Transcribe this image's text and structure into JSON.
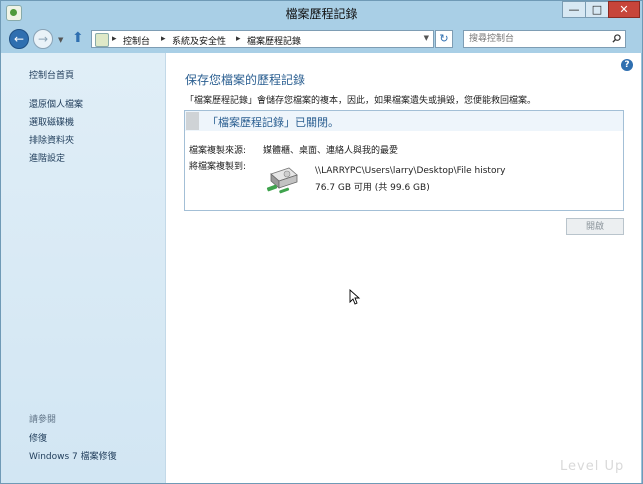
{
  "window": {
    "title": "檔案歷程記錄",
    "minimize_label": "—",
    "maximize_label": "□",
    "close_label": "✕"
  },
  "nav": {
    "back_label": "←",
    "forward_label": "→",
    "up_label": "⬆",
    "breadcrumbs": [
      "控制台",
      "系統及安全性",
      "檔案歷程記錄"
    ],
    "breadcrumb_separator": "▸",
    "search_placeholder": "搜尋控制台"
  },
  "sidebar": {
    "home": "控制台首頁",
    "links": [
      "還原個人檔案",
      "選取磁碟機",
      "排除資料夾",
      "進階設定"
    ],
    "see_also_label": "請參閱",
    "see_also": [
      "修復",
      "Windows 7 檔案修復"
    ]
  },
  "main": {
    "heading": "保存您檔案的歷程記錄",
    "description": "「檔案歷程記錄」會儲存您檔案的複本，因此，如果檔案遺失或損毀，您便能救回檔案。",
    "status_title": "「檔案歷程記錄」已關閉。",
    "source_label": "檔案複製來源:",
    "source_value": "媒體櫃、桌面、連絡人與我的最愛",
    "dest_label": "將檔案複製到:",
    "dest_path": "\\\\LARRYPC\\Users\\larry\\Desktop\\File history",
    "dest_size": "76.7 GB 可用 (共 99.6 GB)",
    "open_button": "開啟"
  },
  "watermark": "Level Up",
  "colors": {
    "frame": "#a9cfe6",
    "close": "#c7453a",
    "heading": "#2b5f91",
    "sidebar": "#dbeaf5"
  },
  "icons": {
    "help": "help-icon",
    "drive": "external-drive-icon",
    "search": "search-icon"
  }
}
